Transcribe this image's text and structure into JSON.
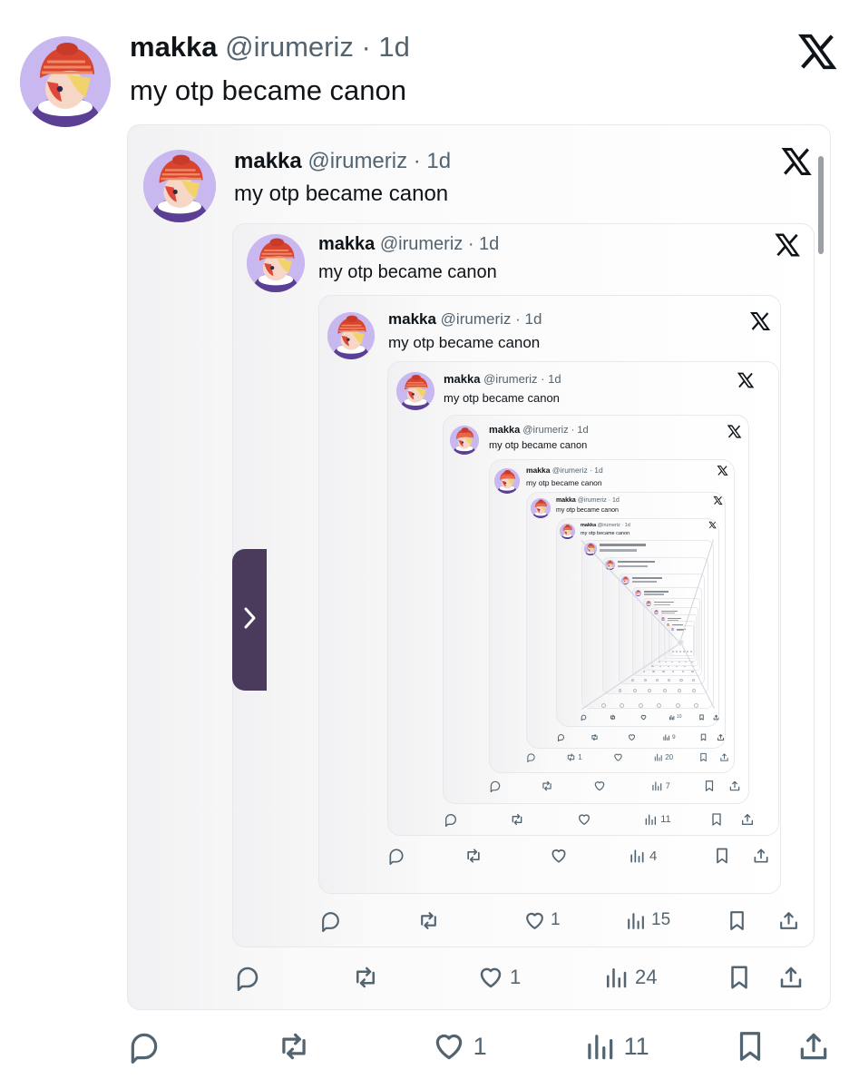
{
  "tweet": {
    "author_name": "makka",
    "handle_time": "@irumeriz · 1d",
    "text": "my otp became canon"
  },
  "levels": [
    {
      "likes": "1",
      "views": "11"
    },
    {
      "likes": "1",
      "views": "24"
    },
    {
      "likes": "1",
      "views": "15"
    },
    {
      "likes": "",
      "views": "4"
    },
    {
      "likes": "",
      "views": "11"
    },
    {
      "likes": "",
      "views": "7"
    },
    {
      "likes": "",
      "views": "20",
      "retweets": "1"
    },
    {
      "likes": "",
      "views": "9"
    },
    {
      "likes": "",
      "views": "10"
    }
  ],
  "icons": {
    "logo": "x-logo-icon",
    "reply": "reply-icon",
    "retweet": "retweet-icon",
    "like": "heart-icon",
    "views": "views-icon",
    "bookmark": "bookmark-icon",
    "share": "share-icon",
    "side_tab": "chevron-right-icon"
  },
  "colors": {
    "text": "#0f1419",
    "secondary": "#536471",
    "border": "#e6e8ec",
    "side_tab": "#4a3a5c"
  }
}
